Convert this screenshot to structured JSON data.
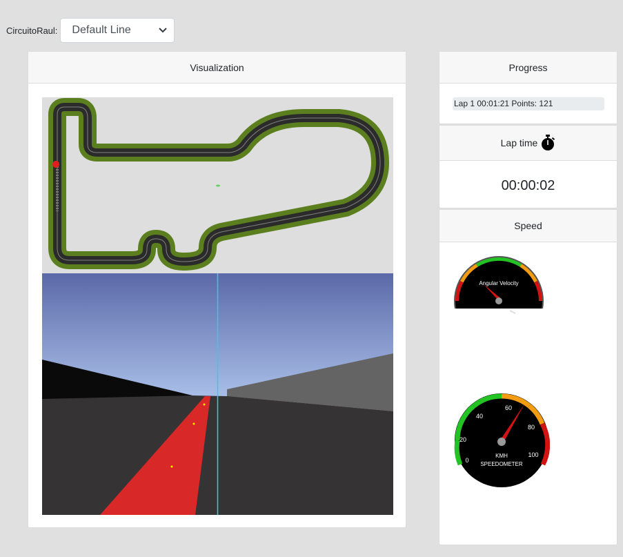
{
  "circuit": {
    "label": "CircuitoRaul:",
    "selected": "Default Line"
  },
  "visualization": {
    "title": "Visualization"
  },
  "progress": {
    "title": "Progress",
    "text": "Lap 1 00:01:21 Points: 121"
  },
  "lap_time": {
    "title": "Lap time",
    "value": "00:00:02",
    "icon": "stopwatch-icon"
  },
  "speed": {
    "title": "Speed",
    "angular_gauge_label": "Angular Velocity",
    "speedometer_unit": "KMH",
    "speedometer_label": "SPEEDOMETER",
    "speedometer_ticks": [
      "0",
      "20",
      "40",
      "60",
      "80",
      "100"
    ],
    "speed_kmh": 62
  },
  "colors": {
    "track_grass": "#5b7e1f",
    "track_asphalt": "#2b2b2b",
    "sky": "#7d8ed2",
    "road": "#373435",
    "line": "#d82828",
    "gauge_green": "#22c322",
    "gauge_orange": "#f39c12",
    "gauge_red": "#d11313"
  }
}
